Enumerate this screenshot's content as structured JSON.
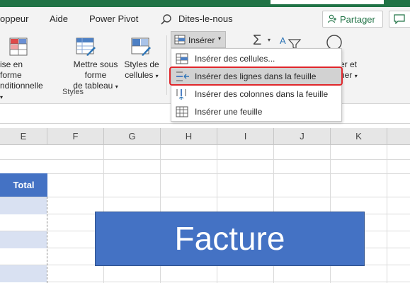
{
  "tabs": [
    "oppeur",
    "Aide",
    "Power Pivot",
    "Dites-le-nous"
  ],
  "share_label": "Partager",
  "ribbon": {
    "format_conditional": [
      "ise en forme",
      "nditionnelle"
    ],
    "format_table": [
      "Mettre sous forme",
      "de tableau"
    ],
    "cell_styles": [
      "Styles de",
      "cellules"
    ],
    "group_styles": "Styles",
    "insert_label": "Insérer",
    "right_partial": [
      "er et",
      "ner"
    ]
  },
  "insert_menu": {
    "items": [
      {
        "label": "Insérer des cellules...",
        "icon": "insert-cells-icon"
      },
      {
        "label": "Insérer des lignes dans la feuille",
        "icon": "insert-rows-icon",
        "highlighted": true
      },
      {
        "label": "Insérer des colonnes dans la feuille",
        "icon": "insert-columns-icon"
      },
      {
        "label": "Insérer une feuille",
        "icon": "insert-sheet-icon"
      }
    ]
  },
  "columns": [
    "E",
    "F",
    "G",
    "H",
    "I",
    "J",
    "K"
  ],
  "cells": {
    "total_header": "Total",
    "facture_title": "Facture"
  },
  "colors": {
    "excel_green": "#217346",
    "table_blue": "#4472c4",
    "band_blue": "#d9e1f2",
    "highlight_red": "#e0262b"
  }
}
